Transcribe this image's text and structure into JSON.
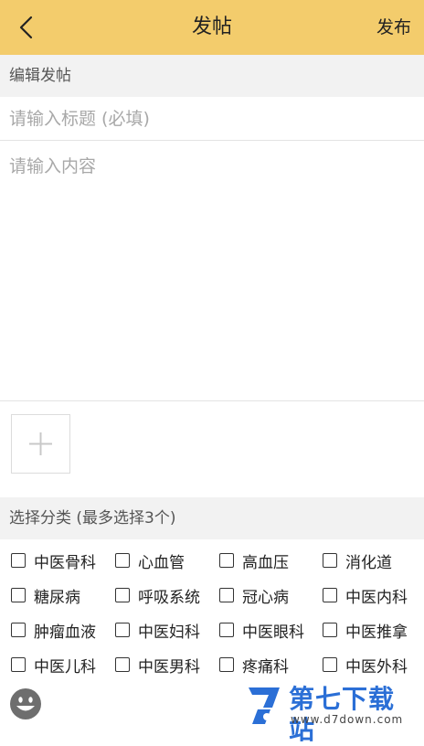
{
  "header": {
    "title": "发帖",
    "publish_label": "发布"
  },
  "edit_section": {
    "label": "编辑发帖",
    "title_placeholder": "请输入标题 (必填)",
    "content_placeholder": "请输入内容"
  },
  "category_section": {
    "label": "选择分类 (最多选择3个)",
    "categories": [
      "中医骨科",
      "心血管",
      "高血压",
      "消化道",
      "糖尿病",
      "呼吸系统",
      "冠心病",
      "中医内科",
      "肿瘤血液",
      "中医妇科",
      "中医眼科",
      "中医推拿",
      "中医儿科",
      "中医男科",
      "疼痛科",
      "中医外科"
    ]
  },
  "watermark": {
    "name": "第七下载站",
    "url": "www.d7down.com"
  },
  "colors": {
    "header_bg": "#f3cc6c",
    "section_bg": "#f2f2f2",
    "watermark_blue": "#2b6fd6"
  },
  "icons": {
    "back": "chevron-left-icon",
    "add_photo": "plus-icon",
    "emoji": "smiley-icon"
  }
}
